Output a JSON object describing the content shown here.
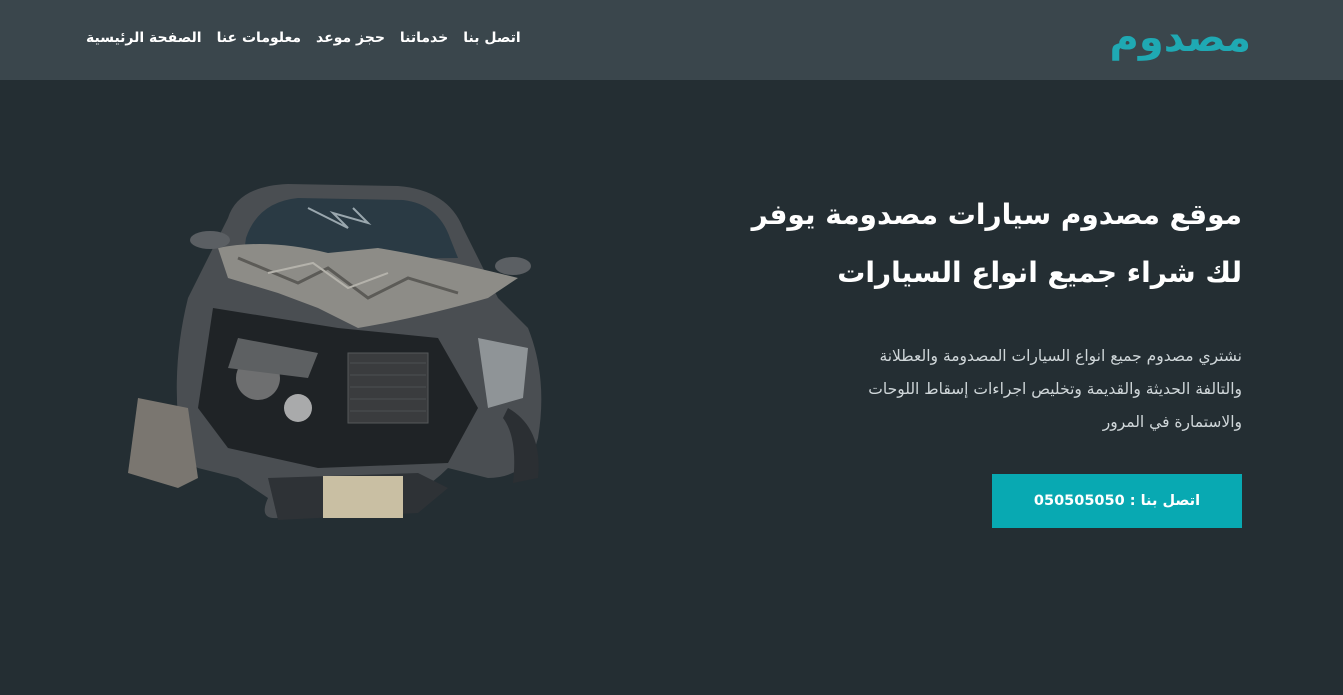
{
  "brand": {
    "logo_text": "مصدوم",
    "accent_color": "#1fa9b3"
  },
  "nav": {
    "items": [
      {
        "label": "اتصل بنا"
      },
      {
        "label": "خدماتنا"
      },
      {
        "label": "حجز موعد"
      },
      {
        "label": "معلومات عنا"
      },
      {
        "label": "الصفحة الرئيسية"
      }
    ]
  },
  "hero": {
    "title_line1": "موقع مصدوم سيارات مصدومة يوفر",
    "title_line2": "لك شراء جميع انواع السيارات",
    "description": "نشتري مصدوم جميع انواع السيارات المصدومة والعطلانة والتالفة الحديثة والقديمة وتخليص اجراءات إسقاط اللوحات والاستمارة في المرور",
    "cta_label": "اتصل بنا : 050505050"
  },
  "image": {
    "subject": "damaged-car-photo"
  }
}
